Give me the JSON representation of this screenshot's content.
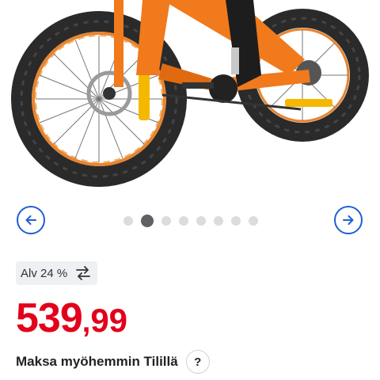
{
  "product_image": {
    "alt": "Orange fat bike"
  },
  "carousel": {
    "prev_icon": "arrow-left-icon",
    "next_icon": "arrow-right-icon",
    "slide_count": 8,
    "active_index": 1,
    "accent_color": "#1f5fd6"
  },
  "vat": {
    "label": "Alv 24 %",
    "icon": "swap-arrows-icon"
  },
  "price": {
    "integer": "539",
    "separator": ",",
    "decimals": "99",
    "color": "#e3001b"
  },
  "pay_later": {
    "label": "Maksa myöhemmin Tilillä",
    "help_label": "?"
  }
}
